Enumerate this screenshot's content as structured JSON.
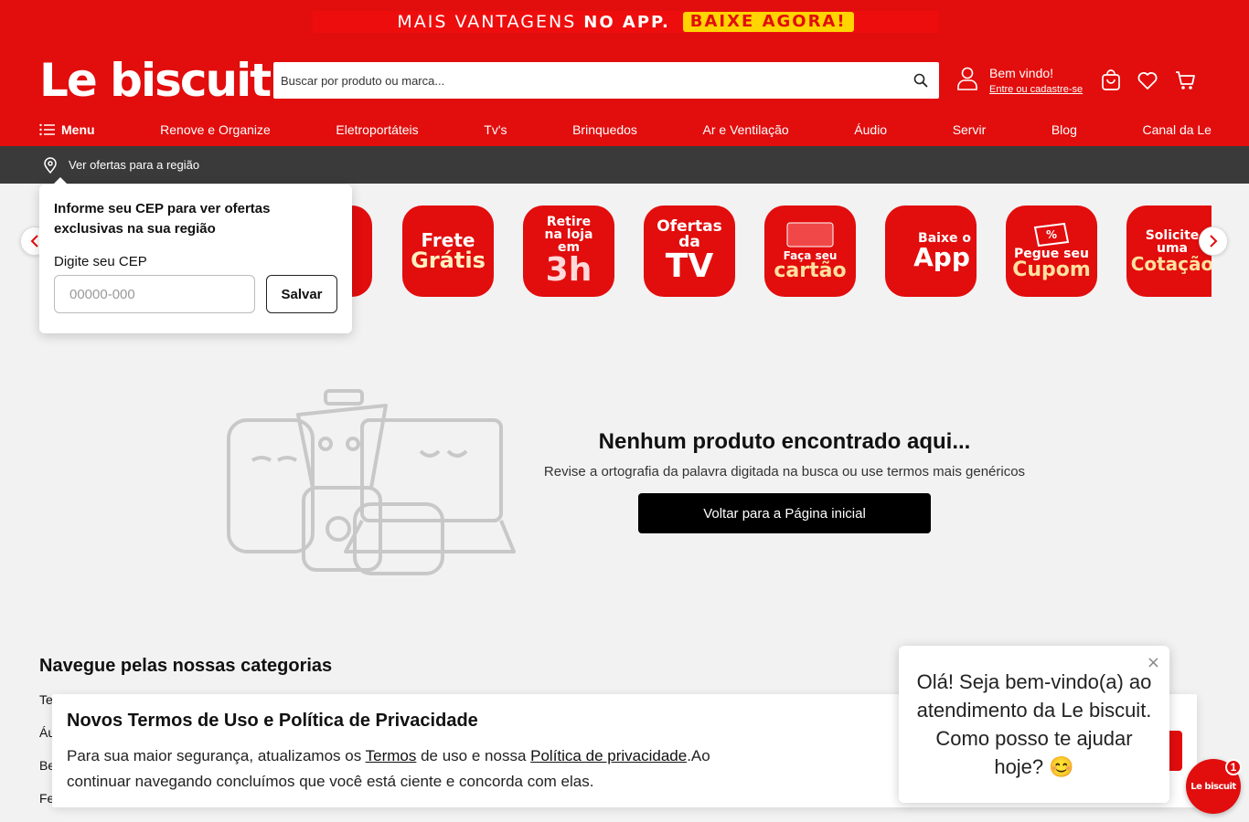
{
  "colors": {
    "brand_red": "#e20d0d",
    "promo_yellow": "#ffd400",
    "region_bar": "#3a3a3a"
  },
  "promo": {
    "text": "MAIS VANTAGENS",
    "bold": "NO APP.",
    "cta": "BAIXE AGORA!"
  },
  "header": {
    "logo": "Le biscuit",
    "search_placeholder": "Buscar por produto ou marca...",
    "user_greeting": "Bem vindo!",
    "user_link": "Entre ou cadastre-se",
    "icons": [
      "search-icon",
      "user-icon",
      "shopping-bag-icon",
      "heart-icon",
      "cart-icon"
    ]
  },
  "nav": {
    "menu_label": "Menu",
    "items": [
      "Renove e Organize",
      "Eletroportáteis",
      "Tv's",
      "Brinquedos",
      "Ar e Ventilação",
      "Áudio",
      "Servir",
      "Blog",
      "Canal da Le"
    ]
  },
  "region": {
    "text": "Ver ofertas para a região"
  },
  "cep_popover": {
    "title": "Informe seu CEP para ver ofertas exclusivas na sua região",
    "label": "Digite seu CEP",
    "placeholder": "00000-000",
    "save": "Salvar"
  },
  "carousel": {
    "tiles": [
      {
        "line1": "Frete",
        "line2": "Grátis"
      },
      {
        "line1": "Retire na loja em",
        "line2": "3h"
      },
      {
        "line1": "Ofertas da",
        "line2": "TV"
      },
      {
        "line1": "Faça seu",
        "line2": "cartão"
      },
      {
        "line1": "Baixe o",
        "line2": "App"
      },
      {
        "line1": "Pegue seu",
        "line2": "Cupom"
      },
      {
        "line1": "Solicite uma",
        "line2": "Cotação"
      }
    ]
  },
  "empty_state": {
    "title": "Nenhum produto encontrado aqui...",
    "subtitle": "Revise a ortografia da palavra digitada na busca ou use termos mais genéricos",
    "button": "Voltar para a Página inicial"
  },
  "categories": {
    "heading": "Navegue pelas nossas categorias",
    "items": [
      "Te",
      "Áu",
      "Be",
      "Fe"
    ]
  },
  "terms": {
    "title": "Novos Termos de Uso e Política de Privacidade",
    "body_1": "Para sua maior segurança, atualizamos os ",
    "link_1": "Termos",
    "body_2": " de uso e nossa ",
    "link_2": "Política de privacidade",
    "body_3": ".Ao continuar navegando concluímos que você está ciente e concorda com elas."
  },
  "chat": {
    "message": "Olá! Seja bem-vindo(a) ao atendimento da Le biscuit. Como posso te ajudar hoje? 😊",
    "close": "×",
    "launcher": "Le biscuit",
    "badge": "1"
  }
}
